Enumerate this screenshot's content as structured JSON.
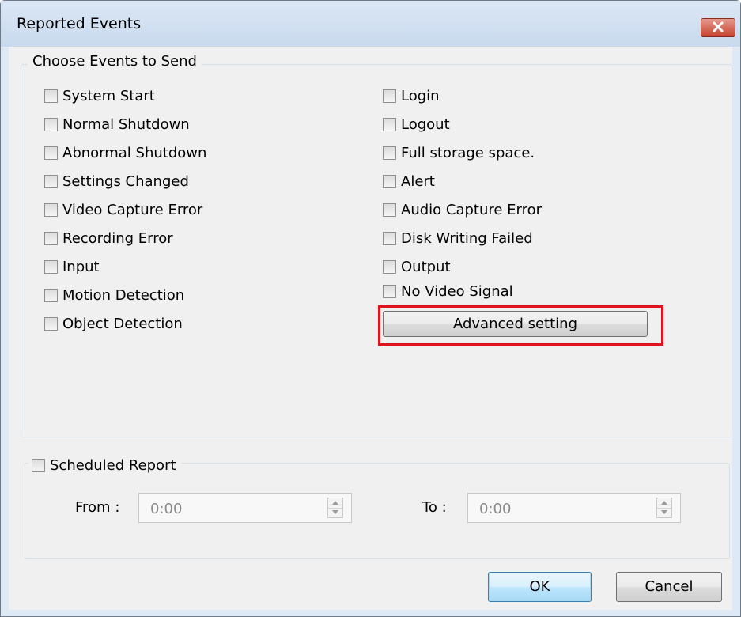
{
  "window": {
    "title": "Reported Events"
  },
  "events_group": {
    "legend": "Choose Events to Send",
    "left_column": [
      "System Start",
      "Normal Shutdown",
      "Abnormal Shutdown",
      "Settings Changed",
      "Video Capture Error",
      "Recording Error",
      "Input",
      "Motion Detection",
      "Object Detection"
    ],
    "right_column": [
      "Login",
      "Logout",
      "Full storage space.",
      "Alert",
      "Audio Capture Error",
      "Disk Writing Failed",
      "Output",
      "No Video Signal"
    ],
    "advanced_button": "Advanced setting"
  },
  "scheduled_group": {
    "checkbox_label": "Scheduled Report",
    "from_label": "From :",
    "from_value": "0:00",
    "to_label": "To :",
    "to_value": "0:00"
  },
  "buttons": {
    "ok": "OK",
    "cancel": "Cancel"
  },
  "colors": {
    "highlight": "#e0141e",
    "title_bg": "#dbe7f5",
    "close_bg": "#c7432f"
  }
}
